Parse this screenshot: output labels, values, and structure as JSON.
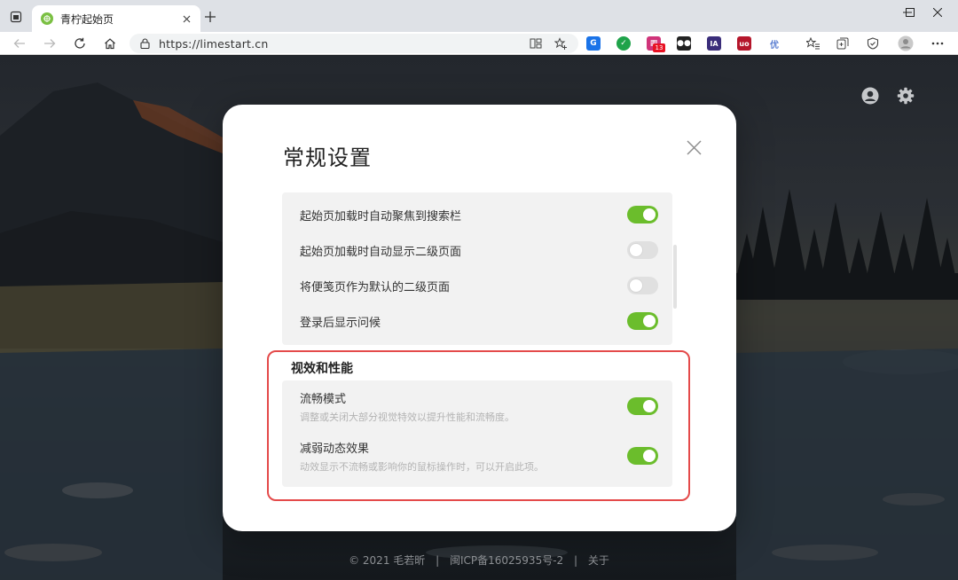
{
  "browser": {
    "tab_title": "青柠起始页",
    "url": "https://limestart.cn",
    "extension_badge": "13",
    "extensions": [
      {
        "name": "chrome-ext-icon",
        "color": "#1a73e8",
        "glyph": "G"
      },
      {
        "name": "green-check-ext-icon",
        "color": "#1fa34a",
        "glyph": "✓"
      },
      {
        "name": "grid-ext-icon",
        "color": "#d0347a",
        "glyph": "▦"
      },
      {
        "name": "dark-ext-icon",
        "color": "#222222",
        "glyph": "●●"
      },
      {
        "name": "ia-ext-icon",
        "color": "#3a2d7a",
        "glyph": "IA"
      },
      {
        "name": "ublock-ext-icon",
        "color": "#b5162b",
        "glyph": "uo"
      },
      {
        "name": "you-ext-icon",
        "color": "#5b7fd1",
        "glyph": "优"
      }
    ]
  },
  "modal": {
    "title": "常规设置",
    "general": [
      {
        "label": "起始页加载时自动聚焦到搜索栏",
        "on": true
      },
      {
        "label": "起始页加载时自动显示二级页面",
        "on": false
      },
      {
        "label": "将便笺页作为默认的二级页面",
        "on": false
      },
      {
        "label": "登录后显示问候",
        "on": true
      }
    ],
    "perf_title": "视效和性能",
    "perf": [
      {
        "label": "流畅模式",
        "desc": "调整或关闭大部分视觉特效以提升性能和流畅度。",
        "on": true
      },
      {
        "label": "减弱动态效果",
        "desc": "动效显示不流畅或影响你的鼠标操作时，可以开启此项。",
        "on": true
      }
    ]
  },
  "footer": {
    "copyright": "© 2021 毛若昕",
    "sep": "|",
    "icp": "闽ICP备16025935号-2",
    "about": "关于"
  },
  "colors": {
    "toggle_on": "#6bbd2c",
    "toggle_off": "#e0e0e0",
    "highlight": "#e44a4a"
  }
}
